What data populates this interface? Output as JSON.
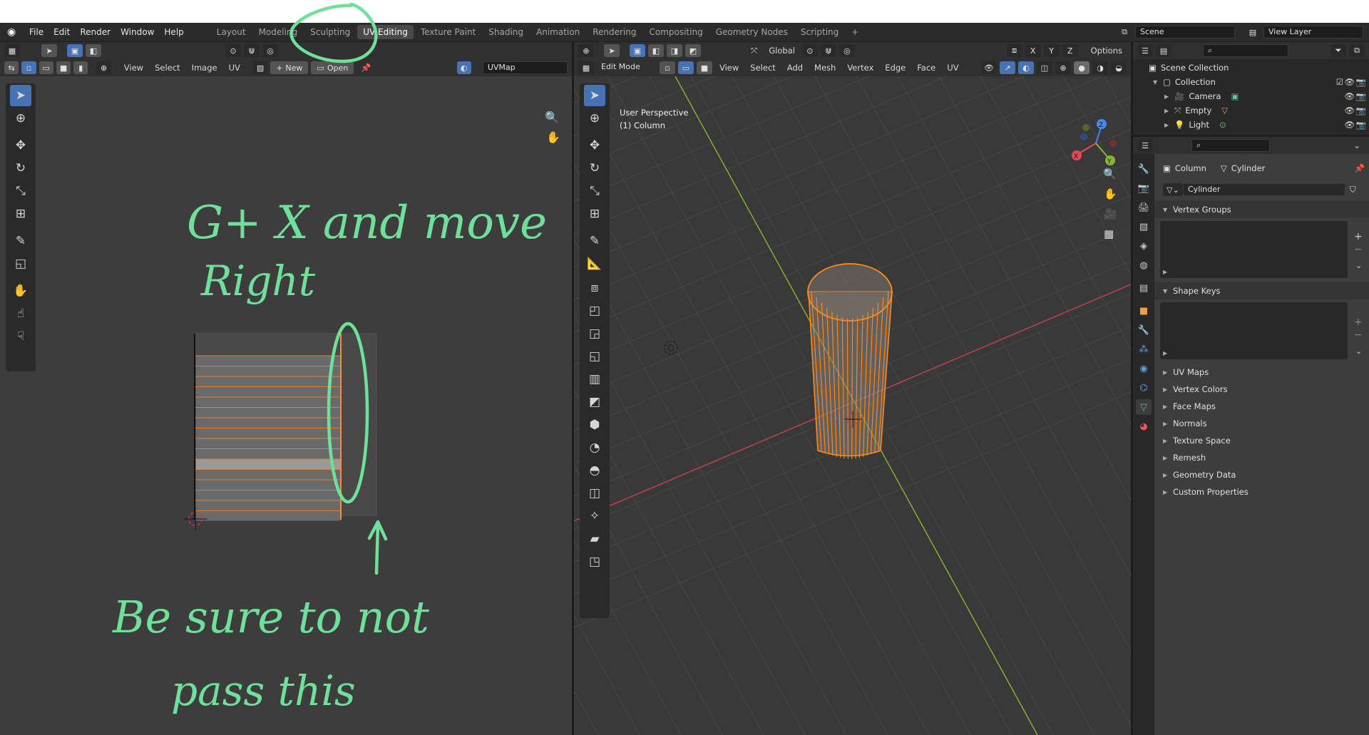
{
  "app": {
    "menus": [
      "File",
      "Edit",
      "Render",
      "Window",
      "Help"
    ],
    "workspaces": [
      "Layout",
      "Modeling",
      "Sculpting",
      "UV Editing",
      "Texture Paint",
      "Shading",
      "Animation",
      "Rendering",
      "Compositing",
      "Geometry Nodes",
      "Scripting"
    ],
    "active_workspace": "UV Editing",
    "scene": "Scene",
    "view_layer": "View Layer"
  },
  "uv_editor": {
    "menus": [
      "View",
      "Select",
      "Image",
      "UV"
    ],
    "new_label": "New",
    "open_label": "Open",
    "uvmap": "UVMap",
    "annotation_top_line1": "G+ X and move",
    "annotation_top_line2": "Right",
    "annotation_bottom_line1": "Be sure to not",
    "annotation_bottom_line2": "pass this"
  },
  "viewport": {
    "mode": "Edit Mode",
    "menus": [
      "View",
      "Select",
      "Add",
      "Mesh",
      "Vertex",
      "Edge",
      "Face",
      "UV"
    ],
    "transform_orientation": "Global",
    "options_label": "Options",
    "axes_toggles": [
      "X",
      "Y",
      "Z"
    ],
    "overlay_title": "User Perspective",
    "overlay_object": "(1) Column",
    "gizmo_labels": [
      "X",
      "Y",
      "Z"
    ]
  },
  "outliner": {
    "root": "Scene Collection",
    "collection": "Collection",
    "items": [
      {
        "name": "Camera",
        "icon": "camera-icon"
      },
      {
        "name": "Empty",
        "icon": "empty-icon"
      },
      {
        "name": "Light",
        "icon": "light-icon"
      }
    ]
  },
  "properties": {
    "breadcrumb_object": "Column",
    "breadcrumb_data": "Cylinder",
    "mesh_name": "Cylinder",
    "panels_open": [
      "Vertex Groups",
      "Shape Keys"
    ],
    "panels_closed": [
      "UV Maps",
      "Vertex Colors",
      "Face Maps",
      "Normals",
      "Texture Space",
      "Remesh",
      "Geometry Data",
      "Custom Properties"
    ]
  },
  "colors": {
    "accent_blue": "#4772b3",
    "selection_orange": "#ff8c1a",
    "annotation_green": "#6fe09a",
    "x_axis_red": "#c6424f",
    "y_axis_green": "#8ab532"
  }
}
